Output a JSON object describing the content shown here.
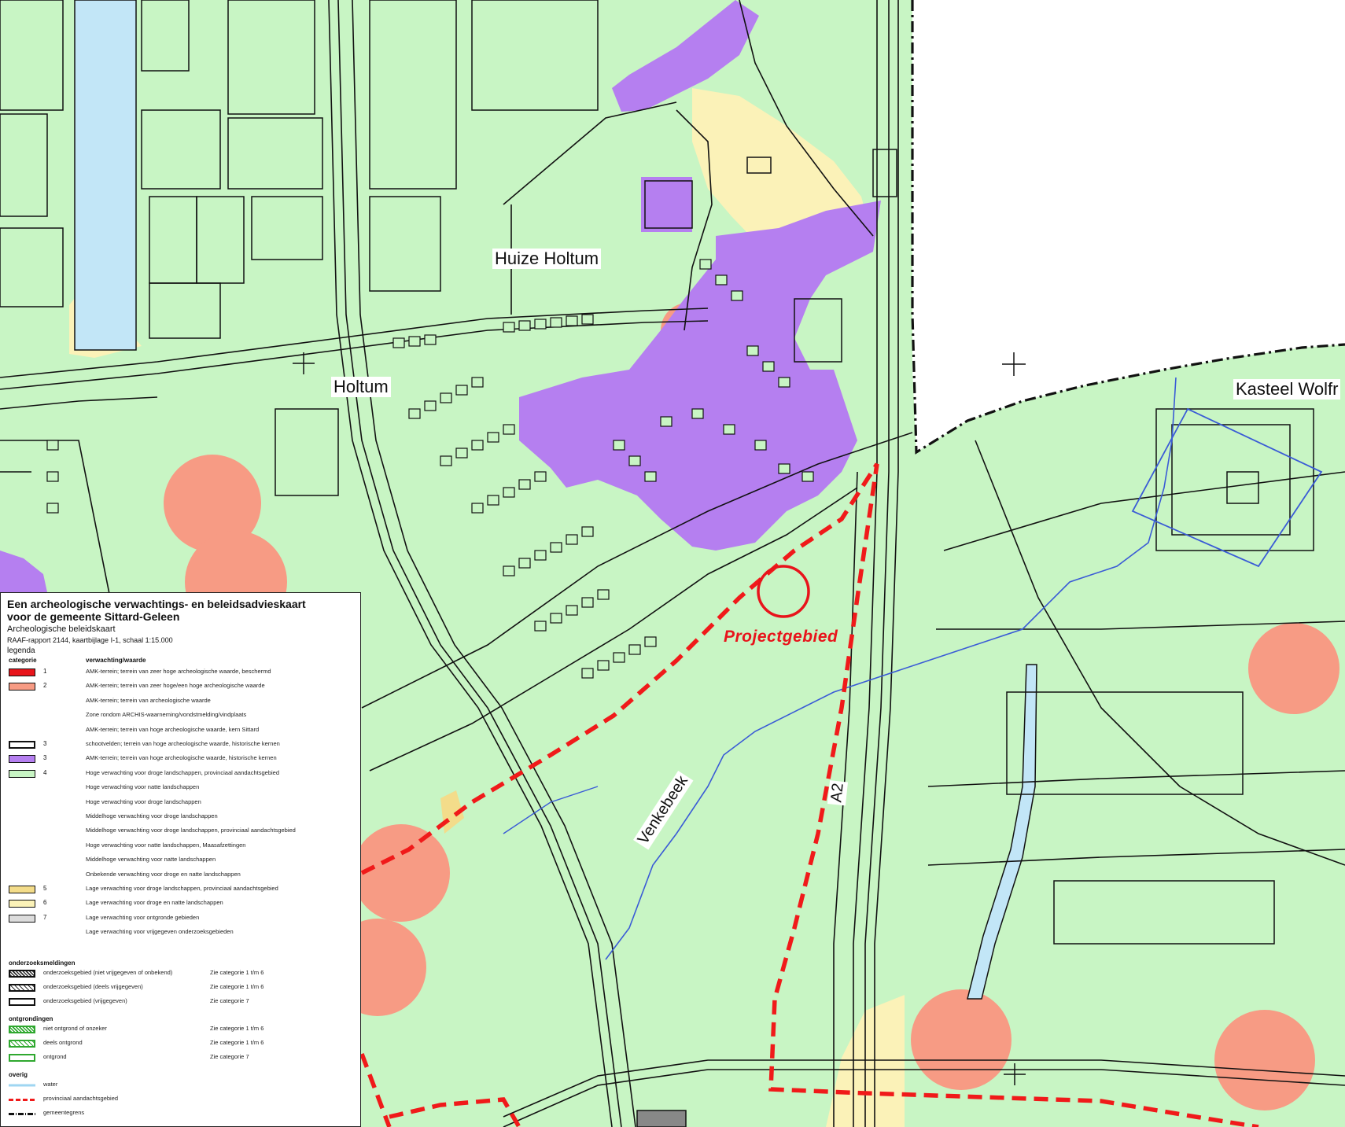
{
  "map": {
    "labels": {
      "huize_holtum": "Huize Holtum",
      "holtum": "Holtum",
      "kasteel_wolfrath": "Kasteel Wolfr",
      "venkebeek": "Venkebeek",
      "a2": "A2",
      "projectgebied": "Projectgebied"
    },
    "colors": {
      "background_land": "#c8f5c4",
      "low_expectation": "#fbf2b8",
      "historic_core": "#b57ff0",
      "amk_high": "#f79b84",
      "water": "#c2e6f7",
      "project_ring": "#e8141b",
      "provincial_area_dash": "#f01a1a",
      "line": "#111111"
    }
  },
  "legend": {
    "title_line1": "Een archeologische verwachtings- en beleidsadvieskaart",
    "title_line2": "voor de gemeente Sittard-Geleen",
    "subtitle": "Archeologische beleidskaart",
    "report": "RAAF-rapport 2144, kaartbijlage I-1, schaal 1:15.000",
    "legenda": "legenda",
    "col_categorie": "categorie",
    "col_verwachting": "verwachting/waarde",
    "categories": [
      {
        "swatch": "#e8141b",
        "border": "#111",
        "code": "1",
        "desc": "AMK-terrein; terrein van zeer hoge archeologische waarde, beschermd"
      },
      {
        "swatch": "#f79b84",
        "border": "#111",
        "code": "2",
        "desc": "AMK-terrein; terrein van zeer hoge/een hoge archeologische waarde"
      },
      {
        "swatch": "",
        "border": "",
        "code": "",
        "desc": "AMK-terrein; terrein van archeologische waarde"
      },
      {
        "swatch": "",
        "border": "",
        "code": "",
        "desc": "Zone rondom ARCHIS-waarneming/vondstmelding/vindplaats"
      },
      {
        "swatch": "",
        "border": "",
        "code": "",
        "desc": "AMK-terrein; terrein van hoge archeologische waarde, kern Sittard"
      },
      {
        "swatch": "#ffffff",
        "border": "#111",
        "code": "3",
        "desc": "schootvelden; terrein van hoge archeologische waarde, historische kernen"
      },
      {
        "swatch": "#b57ff0",
        "border": "#111",
        "code": "3",
        "desc": "AMK-terrein; terrein van hoge archeologische waarde, historische kernen"
      },
      {
        "swatch": "#c8f5c4",
        "border": "#111",
        "code": "4",
        "desc": "Hoge verwachting voor droge landschappen, provinciaal aandachtsgebied"
      },
      {
        "swatch": "",
        "border": "",
        "code": "",
        "desc": "Hoge verwachting voor natte landschappen"
      },
      {
        "swatch": "",
        "border": "",
        "code": "",
        "desc": "Hoge verwachting voor droge landschappen"
      },
      {
        "swatch": "",
        "border": "",
        "code": "",
        "desc": "Middelhoge verwachting voor droge landschappen"
      },
      {
        "swatch": "",
        "border": "",
        "code": "",
        "desc": "Middelhoge verwachting voor droge landschappen, provinciaal aandachtsgebied"
      },
      {
        "swatch": "",
        "border": "",
        "code": "",
        "desc": "Hoge verwachting voor natte landschappen, Maasafzettingen"
      },
      {
        "swatch": "",
        "border": "",
        "code": "",
        "desc": "Middelhoge verwachting voor natte landschappen"
      },
      {
        "swatch": "",
        "border": "",
        "code": "",
        "desc": "Onbekende verwachting voor droge en natte landschappen"
      },
      {
        "swatch": "#f3dc8a",
        "border": "#111",
        "code": "5",
        "desc": "Lage verwachting voor droge landschappen, provinciaal aandachtsgebied"
      },
      {
        "swatch": "#fbf2b8",
        "border": "#111",
        "code": "6",
        "desc": "Lage verwachting voor droge en natte landschappen"
      },
      {
        "swatch": "#dcdcdc",
        "border": "#111",
        "code": "7",
        "desc": "Lage verwachting voor ontgronde gebieden"
      },
      {
        "swatch": "",
        "border": "",
        "code": "",
        "desc": "Lage verwachting voor vrijgegeven onderzoeksgebieden"
      }
    ],
    "onderzoek_title": "onderzoeksmeldingen",
    "onderzoek": [
      {
        "style": "hatch-dense",
        "desc": "onderzoeksgebied (niet vrijgegeven of onbekend)",
        "ref": "Zie categorie 1 t/m 6"
      },
      {
        "style": "hatch",
        "desc": "onderzoeksgebied (deels vrijgegeven)",
        "ref": "Zie categorie 1 t/m 6"
      },
      {
        "style": "outline",
        "desc": "onderzoeksgebied (vrijgegeven)",
        "ref": "Zie categorie 7"
      }
    ],
    "ontgrondingen_title": "ontgrondingen",
    "ontgrondingen": [
      {
        "style": "green-hatch-dense",
        "desc": "niet ontgrond of onzeker",
        "ref": "Zie categorie 1 t/m 6"
      },
      {
        "style": "green-hatch",
        "desc": "deels ontgrond",
        "ref": "Zie categorie 1 t/m 6"
      },
      {
        "style": "green-outline",
        "desc": "ontgrond",
        "ref": "Zie categorie 7"
      }
    ],
    "overig_title": "overig",
    "overig": [
      {
        "style": "water",
        "desc": "water"
      },
      {
        "style": "red-dash",
        "desc": "provinciaal aandachtsgebied"
      },
      {
        "style": "black-dash",
        "desc": "gemeentegrens"
      }
    ]
  }
}
